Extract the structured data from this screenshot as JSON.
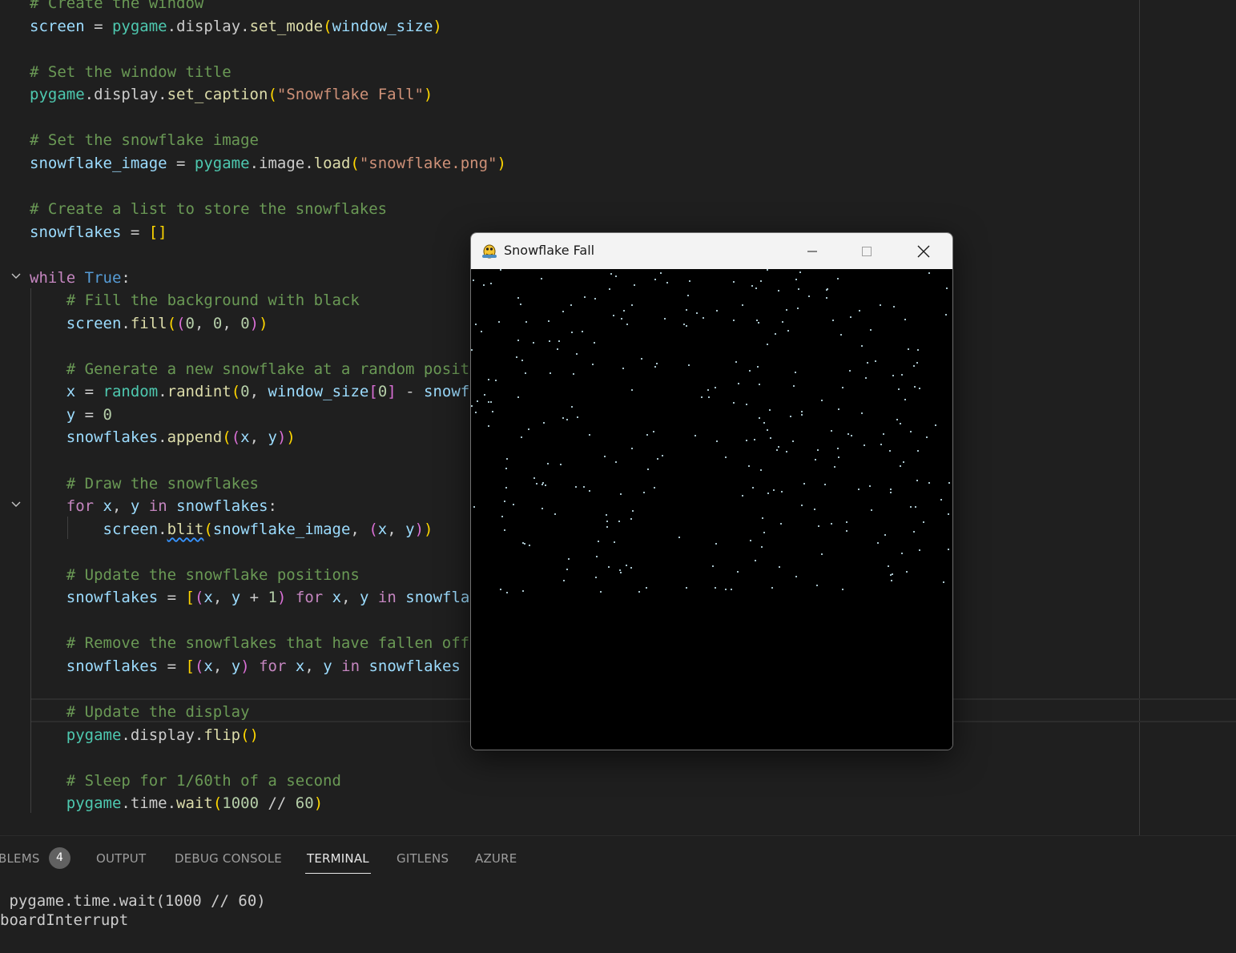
{
  "code_lines": [
    {
      "tokens": [
        [
          "c",
          "# Create the window"
        ]
      ]
    },
    {
      "tokens": [
        [
          "v",
          "screen"
        ],
        [
          "t",
          " = "
        ],
        [
          "m",
          "pygame"
        ],
        [
          "t",
          "."
        ],
        [
          "t",
          "display"
        ],
        [
          "t",
          "."
        ],
        [
          "f",
          "set_mode"
        ],
        [
          "p1",
          "("
        ],
        [
          "v",
          "window_size"
        ],
        [
          "p1",
          ")"
        ]
      ]
    },
    {
      "tokens": []
    },
    {
      "tokens": [
        [
          "c",
          "# Set the window title"
        ]
      ]
    },
    {
      "tokens": [
        [
          "m",
          "pygame"
        ],
        [
          "t",
          ".display."
        ],
        [
          "f",
          "set_caption"
        ],
        [
          "p1",
          "("
        ],
        [
          "s",
          "\"Snowflake Fall\""
        ],
        [
          "p1",
          ")"
        ]
      ]
    },
    {
      "tokens": []
    },
    {
      "tokens": [
        [
          "c",
          "# Set the snowflake image"
        ]
      ]
    },
    {
      "tokens": [
        [
          "v",
          "snowflake_image"
        ],
        [
          "t",
          " = "
        ],
        [
          "m",
          "pygame"
        ],
        [
          "t",
          ".image."
        ],
        [
          "f",
          "load"
        ],
        [
          "p1",
          "("
        ],
        [
          "s",
          "\"snowflake.png\""
        ],
        [
          "p1",
          ")"
        ]
      ]
    },
    {
      "tokens": []
    },
    {
      "tokens": [
        [
          "c",
          "# Create a list to store the snowflakes"
        ]
      ]
    },
    {
      "tokens": [
        [
          "v",
          "snowflakes"
        ],
        [
          "t",
          " = "
        ],
        [
          "p1",
          "[]"
        ]
      ]
    },
    {
      "tokens": []
    },
    {
      "tokens": [
        [
          "k",
          "while"
        ],
        [
          "t",
          " "
        ],
        [
          "b",
          "True"
        ],
        [
          "t",
          ":"
        ]
      ]
    },
    {
      "tokens": [
        [
          "t",
          "    "
        ],
        [
          "c",
          "# Fill the background with black"
        ]
      ]
    },
    {
      "tokens": [
        [
          "t",
          "    "
        ],
        [
          "v",
          "screen"
        ],
        [
          "t",
          "."
        ],
        [
          "f",
          "fill"
        ],
        [
          "p1",
          "("
        ],
        [
          "p2",
          "("
        ],
        [
          "n",
          "0"
        ],
        [
          "t",
          ", "
        ],
        [
          "n",
          "0"
        ],
        [
          "t",
          ", "
        ],
        [
          "n",
          "0"
        ],
        [
          "p2",
          ")"
        ],
        [
          "p1",
          ")"
        ]
      ]
    },
    {
      "tokens": []
    },
    {
      "tokens": [
        [
          "t",
          "    "
        ],
        [
          "c",
          "# Generate a new snowflake at a random posit"
        ]
      ]
    },
    {
      "tokens": [
        [
          "t",
          "    "
        ],
        [
          "v",
          "x"
        ],
        [
          "t",
          " = "
        ],
        [
          "m",
          "random"
        ],
        [
          "t",
          "."
        ],
        [
          "f",
          "randint"
        ],
        [
          "p1",
          "("
        ],
        [
          "n",
          "0"
        ],
        [
          "t",
          ", "
        ],
        [
          "v",
          "window_size"
        ],
        [
          "p2",
          "["
        ],
        [
          "n",
          "0"
        ],
        [
          "p2",
          "]"
        ],
        [
          "t",
          " - "
        ],
        [
          "v",
          "snowf"
        ]
      ]
    },
    {
      "tokens": [
        [
          "t",
          "    "
        ],
        [
          "v",
          "y"
        ],
        [
          "t",
          " = "
        ],
        [
          "n",
          "0"
        ]
      ]
    },
    {
      "tokens": [
        [
          "t",
          "    "
        ],
        [
          "v",
          "snowflakes"
        ],
        [
          "t",
          "."
        ],
        [
          "f",
          "append"
        ],
        [
          "p1",
          "("
        ],
        [
          "p2",
          "("
        ],
        [
          "v",
          "x"
        ],
        [
          "t",
          ", "
        ],
        [
          "v",
          "y"
        ],
        [
          "p2",
          ")"
        ],
        [
          "p1",
          ")"
        ]
      ]
    },
    {
      "tokens": []
    },
    {
      "tokens": [
        [
          "t",
          "    "
        ],
        [
          "c",
          "# Draw the snowflakes"
        ]
      ]
    },
    {
      "tokens": [
        [
          "t",
          "    "
        ],
        [
          "k",
          "for"
        ],
        [
          "t",
          " "
        ],
        [
          "v",
          "x"
        ],
        [
          "t",
          ", "
        ],
        [
          "v",
          "y"
        ],
        [
          "t",
          " "
        ],
        [
          "k",
          "in"
        ],
        [
          "t",
          " "
        ],
        [
          "v",
          "snowflakes"
        ],
        [
          "t",
          ":"
        ]
      ]
    },
    {
      "tokens": [
        [
          "t",
          "        "
        ],
        [
          "v",
          "screen"
        ],
        [
          "t",
          "."
        ],
        [
          "fsq",
          "blit"
        ],
        [
          "p1",
          "("
        ],
        [
          "v",
          "snowflake_image"
        ],
        [
          "t",
          ", "
        ],
        [
          "p2",
          "("
        ],
        [
          "v",
          "x"
        ],
        [
          "t",
          ", "
        ],
        [
          "v",
          "y"
        ],
        [
          "p2",
          ")"
        ],
        [
          "p1",
          ")"
        ]
      ]
    },
    {
      "tokens": []
    },
    {
      "tokens": [
        [
          "t",
          "    "
        ],
        [
          "c",
          "# Update the snowflake positions"
        ]
      ]
    },
    {
      "tokens": [
        [
          "t",
          "    "
        ],
        [
          "v",
          "snowflakes"
        ],
        [
          "t",
          " = "
        ],
        [
          "p1",
          "["
        ],
        [
          "p2",
          "("
        ],
        [
          "v",
          "x"
        ],
        [
          "t",
          ", "
        ],
        [
          "v",
          "y"
        ],
        [
          "t",
          " + "
        ],
        [
          "n",
          "1"
        ],
        [
          "p2",
          ")"
        ],
        [
          "t",
          " "
        ],
        [
          "k",
          "for"
        ],
        [
          "t",
          " "
        ],
        [
          "v",
          "x"
        ],
        [
          "t",
          ", "
        ],
        [
          "v",
          "y"
        ],
        [
          "t",
          " "
        ],
        [
          "k",
          "in"
        ],
        [
          "t",
          " "
        ],
        [
          "v",
          "snowfla"
        ]
      ]
    },
    {
      "tokens": []
    },
    {
      "tokens": [
        [
          "t",
          "    "
        ],
        [
          "c",
          "# Remove the snowflakes that have fallen off"
        ]
      ]
    },
    {
      "tokens": [
        [
          "t",
          "    "
        ],
        [
          "v",
          "snowflakes"
        ],
        [
          "t",
          " = "
        ],
        [
          "p1",
          "["
        ],
        [
          "p2",
          "("
        ],
        [
          "v",
          "x"
        ],
        [
          "t",
          ", "
        ],
        [
          "v",
          "y"
        ],
        [
          "p2",
          ")"
        ],
        [
          "t",
          " "
        ],
        [
          "k",
          "for"
        ],
        [
          "t",
          " "
        ],
        [
          "v",
          "x"
        ],
        [
          "t",
          ", "
        ],
        [
          "v",
          "y"
        ],
        [
          "t",
          " "
        ],
        [
          "k",
          "in"
        ],
        [
          "t",
          " "
        ],
        [
          "v",
          "snowflakes"
        ]
      ]
    },
    {
      "tokens": []
    },
    {
      "tokens": [
        [
          "t",
          "    "
        ],
        [
          "c",
          "# Update the display"
        ]
      ]
    },
    {
      "tokens": [
        [
          "t",
          "    "
        ],
        [
          "m",
          "pygame"
        ],
        [
          "t",
          ".display."
        ],
        [
          "f",
          "flip"
        ],
        [
          "p1",
          "()"
        ]
      ]
    },
    {
      "tokens": []
    },
    {
      "tokens": [
        [
          "t",
          "    "
        ],
        [
          "c",
          "# Sleep for 1/60th of a second"
        ]
      ]
    },
    {
      "tokens": [
        [
          "t",
          "    "
        ],
        [
          "m",
          "pygame"
        ],
        [
          "t",
          ".time."
        ],
        [
          "f",
          "wait"
        ],
        [
          "p1",
          "("
        ],
        [
          "n",
          "1000"
        ],
        [
          "t",
          " // "
        ],
        [
          "n",
          "60"
        ],
        [
          "p1",
          ")"
        ]
      ]
    }
  ],
  "panel": {
    "tabs": [
      {
        "label": "BLEMS",
        "active": false
      },
      {
        "label": "OUTPUT",
        "active": false
      },
      {
        "label": "DEBUG CONSOLE",
        "active": false
      },
      {
        "label": "TERMINAL",
        "active": true
      },
      {
        "label": "GITLENS",
        "active": false
      },
      {
        "label": "AZURE",
        "active": false
      }
    ],
    "problems_count": "4",
    "terminal_lines": [
      " pygame.time.wait(1000 // 60)",
      "boardInterrupt"
    ]
  },
  "window": {
    "title": "Snowflake Fall",
    "icons": {
      "app": "pygame-snake-icon",
      "minimize": "minimize-icon",
      "maximize": "maximize-icon",
      "close": "close-icon"
    },
    "snowflake_color": "#a9c4cc"
  },
  "colors": {
    "editor_bg": "#1f1f1f",
    "comment": "#6a9955",
    "keyword": "#c586c0",
    "string": "#ce9178"
  }
}
